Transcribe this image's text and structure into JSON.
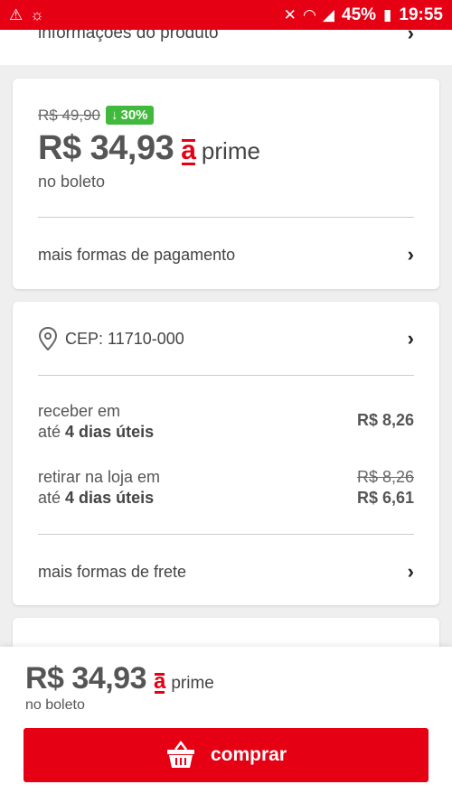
{
  "status_bar": {
    "left_icons": [
      "warning-icon",
      "cast-icon"
    ],
    "battery": "45%",
    "time": "19:55"
  },
  "top_section": {
    "label": "informações do produto"
  },
  "price_card": {
    "old_price": "R$ 49,90",
    "discount": "30%",
    "price": "R$ 34,93",
    "prime_logo": "a",
    "prime_label": "prime",
    "payment_note": "no boleto",
    "more_payment_link": "mais formas de pagamento"
  },
  "shipping_card": {
    "cep_label": "CEP: 11710-000",
    "options": [
      {
        "line1": "receber em",
        "line2_prefix": "até",
        "line2_bold": "4 dias úteis",
        "price": "R$ 8,26",
        "old_price": ""
      },
      {
        "line1": "retirar na loja em",
        "line2_prefix": "até",
        "line2_bold": "4 dias úteis",
        "price": "R$ 6,61",
        "old_price": "R$ 8,26"
      }
    ],
    "more_shipping_link": "mais formas de frete"
  },
  "bottom_bar": {
    "price": "R$ 34,93",
    "prime_logo": "a",
    "prime_label": "prime",
    "payment_note": "no boleto",
    "buy_label": "comprar"
  },
  "colors": {
    "accent": "#e60014",
    "discount_badge": "#40b93c"
  }
}
